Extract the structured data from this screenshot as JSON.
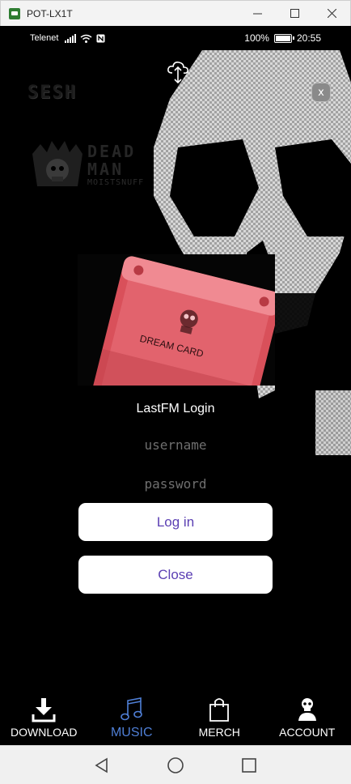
{
  "window": {
    "title": "POT-LX1T"
  },
  "statusbar": {
    "carrier": "Telenet",
    "battery": "100%",
    "battery_level": 1.0,
    "time": "20:55"
  },
  "background": {
    "sesh": "SESH",
    "deadman_line1": "DEAD",
    "deadman_line2": "MAN",
    "deadman_sub": "MOISTSNUFF"
  },
  "dialog": {
    "close_label": "x",
    "card_text": "DREAM CARD",
    "title": "LastFM Login",
    "username_placeholder": "username",
    "password_placeholder": "password",
    "login_label": "Log in",
    "close_button_label": "Close"
  },
  "nav": {
    "items": [
      {
        "label": "DOWNLOAD",
        "icon": "download-icon"
      },
      {
        "label": "MUSIC",
        "icon": "music-note-icon",
        "active": true
      },
      {
        "label": "MERCH",
        "icon": "shopping-bag-icon"
      },
      {
        "label": "ACCOUNT",
        "icon": "skull-account-icon"
      }
    ]
  },
  "colors": {
    "accent": "#5b3fb3",
    "active_nav": "#4f7fd6",
    "card": "#e0545c"
  }
}
